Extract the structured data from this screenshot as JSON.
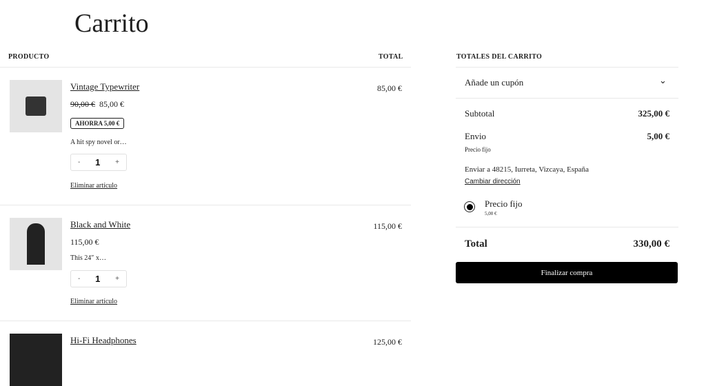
{
  "page": {
    "title": "Carrito"
  },
  "table": {
    "col_product": "PRODUCTO",
    "col_total": "TOTAL"
  },
  "items": [
    {
      "name": "Vintage Typewriter",
      "old_price": "90,00 €",
      "price": "85,00 €",
      "badge": "AHORRA 5,00 €",
      "description": "A hit spy novel or…",
      "quantity": "1",
      "total": "85,00 €",
      "remove": "Eliminar artículo"
    },
    {
      "name": "Black and White",
      "price": "115,00 €",
      "description": "This 24″ x…",
      "quantity": "1",
      "total": "115,00 €",
      "remove": "Eliminar artículo"
    },
    {
      "name": "Hi-Fi Headphones",
      "total": "125,00 €"
    }
  ],
  "qty_controls": {
    "minus": "-",
    "plus": "+"
  },
  "totals": {
    "title": "TOTALES DEL CARRITO",
    "coupon": "Añade un cupón",
    "subtotal_label": "Subtotal",
    "subtotal": "325,00 €",
    "shipping_label": "Envio",
    "shipping": "5,00 €",
    "shipping_method": "Precio fijo",
    "ship_to": "Enviar a 48215, Iurreta, Vizcaya, España",
    "change_address": "Cambiar dirección",
    "option_label": "Precio fijo",
    "option_price": "5,00 €",
    "total_label": "Total",
    "total": "330,00 €",
    "checkout": "Finalizar compra"
  }
}
